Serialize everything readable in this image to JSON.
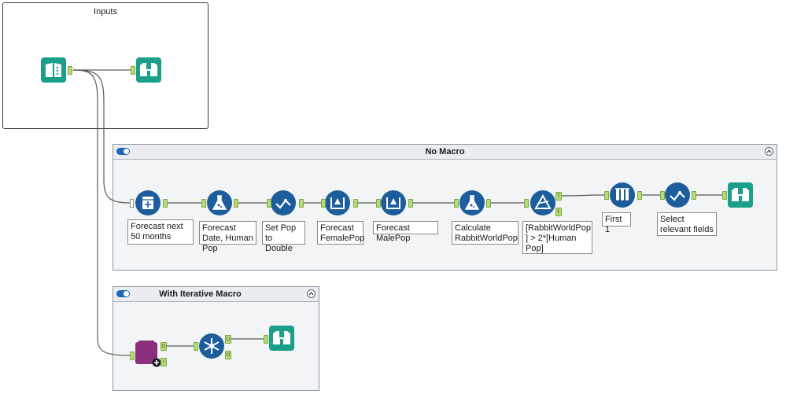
{
  "containers": {
    "inputs": {
      "title": "Inputs"
    },
    "no_macro": {
      "title": "No Macro"
    },
    "iterative": {
      "title": "With Iterative Macro"
    }
  },
  "annotations": {
    "forecast_months": "Forecast next 50 months",
    "forecast_date": "Forecast Date, Human Pop",
    "set_pop": "Set Pop to Double",
    "forecast_female": "Forecast FemalePop",
    "forecast_male": "Forecast MalePop",
    "calc_rabbit": "Calculate RabbitWorldPop",
    "filter_expr": "[RabbitWorldPop ] > 2*[Human Pop]",
    "first_one": "First 1",
    "select_fields": "Select relevant fields"
  },
  "anchors": {
    "true": "T",
    "false": "F",
    "output": "O",
    "input": "I",
    "unique": "U",
    "duplicate": "D"
  },
  "colors": {
    "teal": "#1b9e8a",
    "blue": "#1e5d9c",
    "purple": "#8c2f7e",
    "anchor_green": "#b6d97a",
    "wire": "#5a5a5a"
  },
  "icons": [
    "text-input-icon",
    "browse-icon",
    "generate-rows-icon",
    "formula-icon",
    "select-icon",
    "crosstab-icon",
    "filter-icon",
    "sample-icon",
    "macro-icon",
    "unique-icon"
  ]
}
